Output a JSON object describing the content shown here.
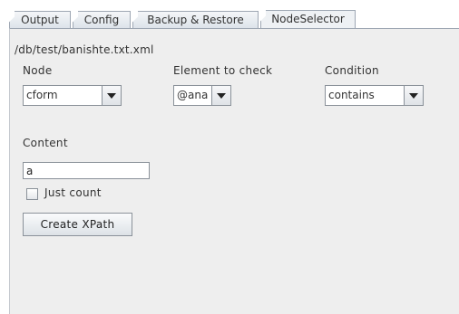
{
  "tabs": [
    {
      "label": "Output"
    },
    {
      "label": "Config"
    },
    {
      "label": "Backup & Restore"
    },
    {
      "label": "NodeSelector",
      "selected": true
    }
  ],
  "node_selector": {
    "path": "/db/test/banishte.txt.xml",
    "node": {
      "label": "Node",
      "value": "cform"
    },
    "element": {
      "label": "Element to check",
      "value": "@ana"
    },
    "condition": {
      "label": "Condition",
      "value": "contains"
    },
    "content": {
      "label": "Content",
      "value": "a"
    },
    "just_count": {
      "label": "Just count",
      "checked": false
    },
    "create_button": "Create XPath"
  }
}
